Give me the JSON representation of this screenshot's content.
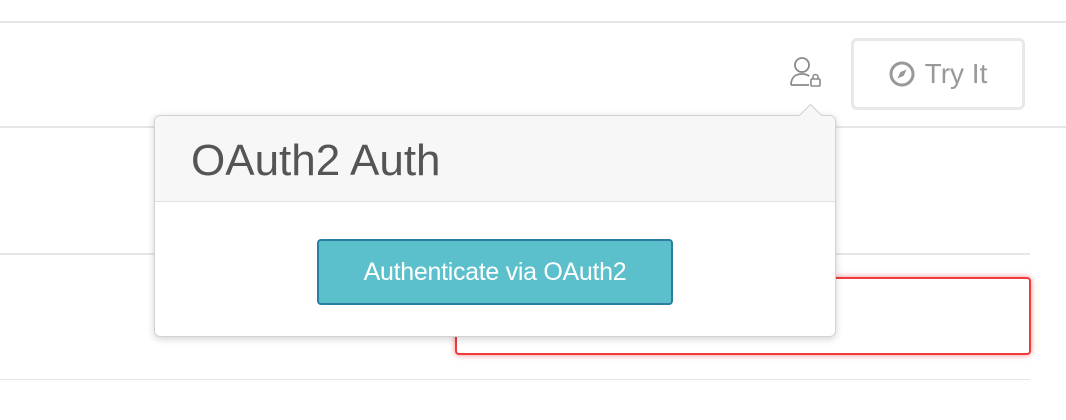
{
  "toolbar": {
    "auth_icon": "user-lock-icon",
    "try_it": {
      "icon": "compass-icon",
      "label": "Try It"
    }
  },
  "popover": {
    "title": "OAuth2 Auth",
    "authenticate_button_label": "Authenticate via OAuth2"
  },
  "colors": {
    "accent_button": "#5bc0cc",
    "accent_button_border": "#2a7fa0",
    "error_border": "#ee3b3b",
    "muted_text": "#999999",
    "title_text": "#555555"
  }
}
